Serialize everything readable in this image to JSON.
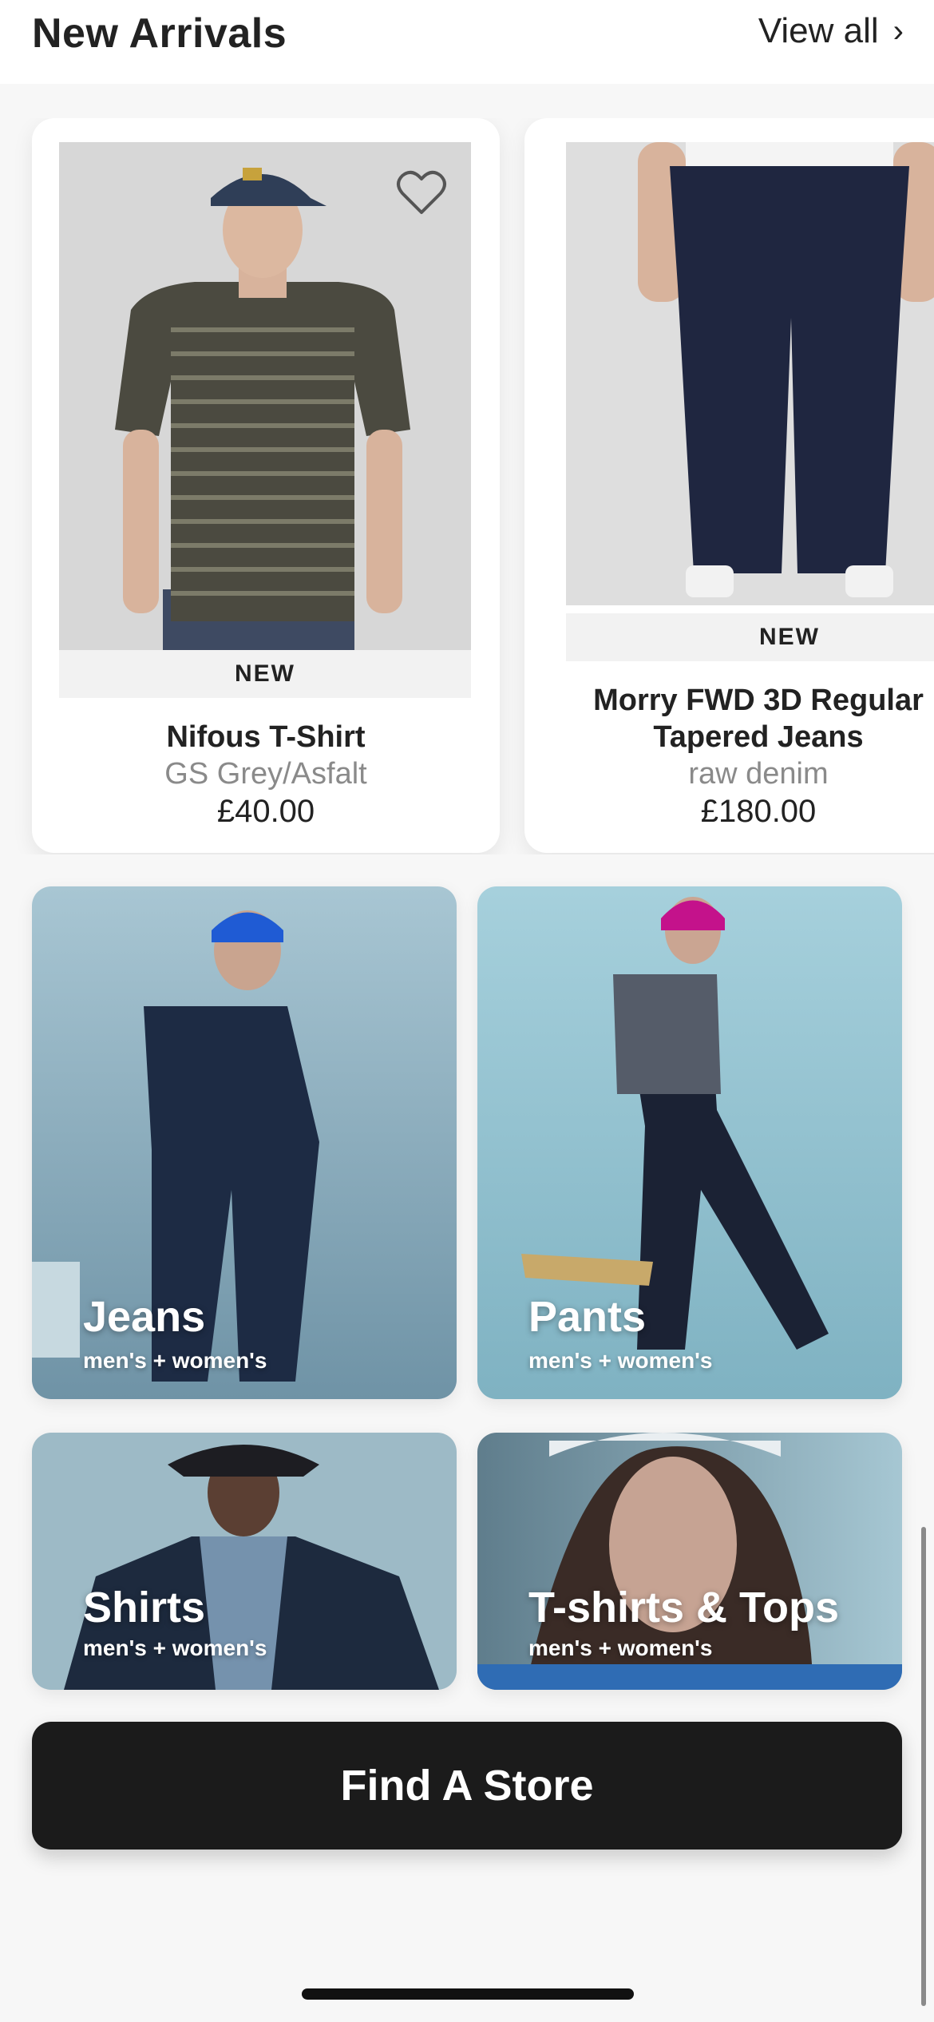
{
  "header": {
    "title": "New Arrivals",
    "view_all": "View all",
    "chevron_icon": "chevron-right-icon"
  },
  "products": [
    {
      "badge": "NEW",
      "name": "Nifous T-Shirt",
      "color": "GS Grey/Asfalt",
      "price": "£40.00",
      "favorite_icon": "heart-outline-icon"
    },
    {
      "badge": "NEW",
      "name_line1": "Morry FWD 3D Regular",
      "name_line2": "Tapered Jeans",
      "color": "raw denim",
      "price": "£180.00",
      "favorite_icon": "heart-outline-icon"
    }
  ],
  "categories": [
    {
      "title": "Jeans",
      "subtitle": "men's + women's"
    },
    {
      "title": "Pants",
      "subtitle": "men's + women's"
    },
    {
      "title": "Shirts",
      "subtitle": "men's + women's"
    },
    {
      "title": "T-shirts & Tops",
      "subtitle": "men's + women's"
    }
  ],
  "cta": {
    "label": "Find A Store"
  },
  "colors": {
    "background": "#f7f7f7",
    "card": "#ffffff",
    "cta_background": "#1b1b1b",
    "muted_text": "#8a8a8a"
  }
}
